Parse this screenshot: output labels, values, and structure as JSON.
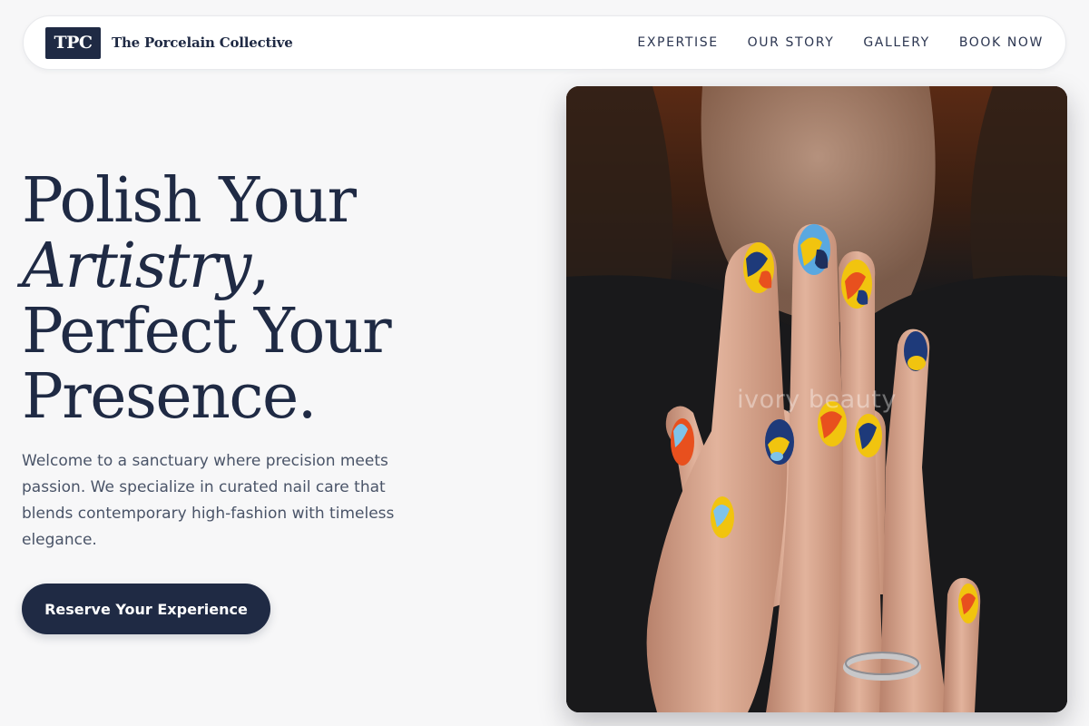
{
  "brand": {
    "logo_text": "TPC",
    "name": "The Porcelain Collective"
  },
  "nav": {
    "links": [
      "EXPERTISE",
      "OUR STORY",
      "GALLERY",
      "BOOK NOW"
    ]
  },
  "hero": {
    "title_line1": "Polish Your",
    "title_italic": "Artistry",
    "title_comma": ",",
    "title_line3": "Perfect Your",
    "title_line4": "Presence.",
    "description": "Welcome to a sanctuary where precision meets passion. We specialize in curated nail care that blends contemporary high-fashion with timeless elegance.",
    "cta_label": "Reserve Your Experience"
  },
  "image": {
    "watermark": "ivory beauty"
  },
  "colors": {
    "primary": "#1f2a44",
    "background": "#f7f7f8",
    "body_text": "#4a5468"
  }
}
